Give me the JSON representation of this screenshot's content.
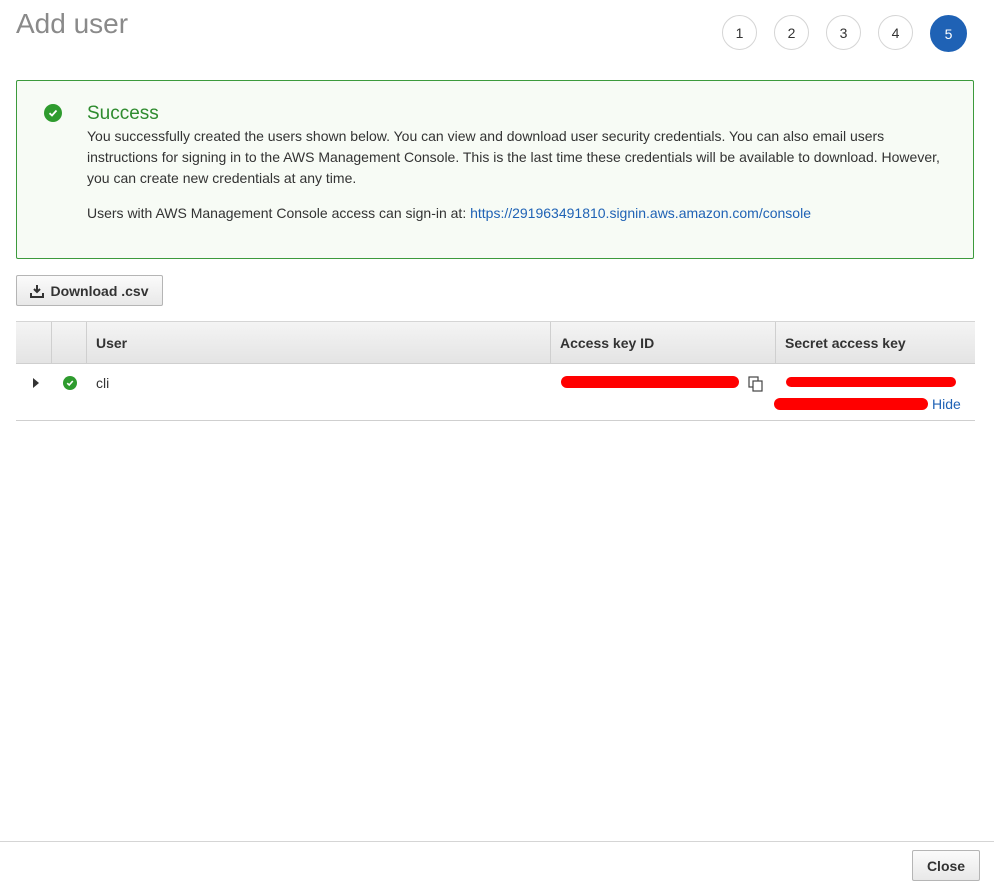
{
  "header": {
    "title": "Add user"
  },
  "steps": [
    {
      "label": "1",
      "active": false
    },
    {
      "label": "2",
      "active": false
    },
    {
      "label": "3",
      "active": false
    },
    {
      "label": "4",
      "active": false
    },
    {
      "label": "5",
      "active": true
    }
  ],
  "alert": {
    "title": "Success",
    "body": "You successfully created the users shown below. You can view and download user security credentials. You can also email users instructions for signing in to the AWS Management Console. This is the last time these credentials will be available to download. However, you can create new credentials at any time.",
    "signin_prefix": "Users with AWS Management Console access can sign-in at: ",
    "signin_url": "https://291963491810.signin.aws.amazon.com/console"
  },
  "toolbar": {
    "download_label": "Download .csv"
  },
  "table": {
    "columns": [
      "",
      "",
      "User",
      "Access key ID",
      "Secret access key"
    ],
    "rows": [
      {
        "user": "cli",
        "hide_label": "Hide"
      }
    ]
  },
  "footer": {
    "close_label": "Close"
  },
  "colors": {
    "accent": "#1f62b5",
    "success": "#2e9b2e",
    "redaction": "#ff0000"
  }
}
